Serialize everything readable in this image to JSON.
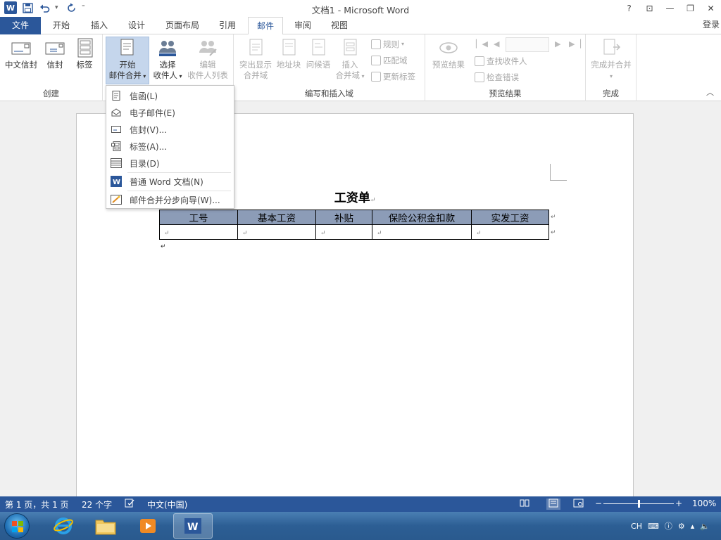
{
  "window": {
    "title": "文档1 - Microsoft Word",
    "app_icon_letter": "W",
    "controls": {
      "help": "?",
      "ribbon_display": "⊡",
      "minimize": "—",
      "restore": "❐",
      "close": "✕"
    }
  },
  "tabs": [
    {
      "label": "文件"
    },
    {
      "label": "开始"
    },
    {
      "label": "插入"
    },
    {
      "label": "设计"
    },
    {
      "label": "页面布局"
    },
    {
      "label": "引用"
    },
    {
      "label": "邮件"
    },
    {
      "label": "审阅"
    },
    {
      "label": "视图"
    }
  ],
  "active_tab": "邮件",
  "login": "登录",
  "ribbon": {
    "create": {
      "label": "创建",
      "chinese_envelope": "中文信封",
      "envelope": "信封",
      "labels": "标签"
    },
    "start_merge": {
      "start_line1": "开始",
      "start_line2": "邮件合并",
      "select_line1": "选择",
      "select_line2": "收件人",
      "edit_line1": "编辑",
      "edit_line2": "收件人列表"
    },
    "write_insert": {
      "label": "编写和插入域",
      "highlight_line1": "突出显示",
      "highlight_line2": "合并域",
      "address_block": "地址块",
      "greeting": "问候语",
      "insert_line1": "插入",
      "insert_line2": "合并域",
      "rules": "规则",
      "match_fields": "匹配域",
      "update_labels": "更新标签"
    },
    "preview": {
      "label": "预览结果",
      "preview_results": "预览结果",
      "find_recipient": "查找收件人",
      "check_errors": "检查错误"
    },
    "finish": {
      "label": "完成",
      "finish_merge": "完成并合并"
    }
  },
  "menu": {
    "items": [
      {
        "label": "信函(L)"
      },
      {
        "label": "电子邮件(E)"
      },
      {
        "label": "信封(V)..."
      },
      {
        "label": "标签(A)..."
      },
      {
        "label": "目录(D)"
      },
      {
        "label": "普通 Word 文档(N)"
      },
      {
        "label": "邮件合并分步向导(W)..."
      }
    ]
  },
  "document": {
    "title": "工资单",
    "pilcrow": "↵",
    "table_headers": [
      "工号",
      "基本工资",
      "补贴",
      "保险公积金扣款",
      "实发工资"
    ],
    "table_row": [
      "↵",
      "↵",
      "↵",
      "↵",
      "↵"
    ]
  },
  "status": {
    "page": "第 1 页，共 1 页",
    "words": "22 个字",
    "language": "中文(中国)",
    "zoom": "100%",
    "zoom_minus": "−",
    "zoom_plus": "+",
    "zoom_fraction": 0.5
  },
  "tray": {
    "ime": "CH"
  },
  "colors": {
    "word_blue": "#2b579a",
    "table_header": "#8c9cb7"
  }
}
